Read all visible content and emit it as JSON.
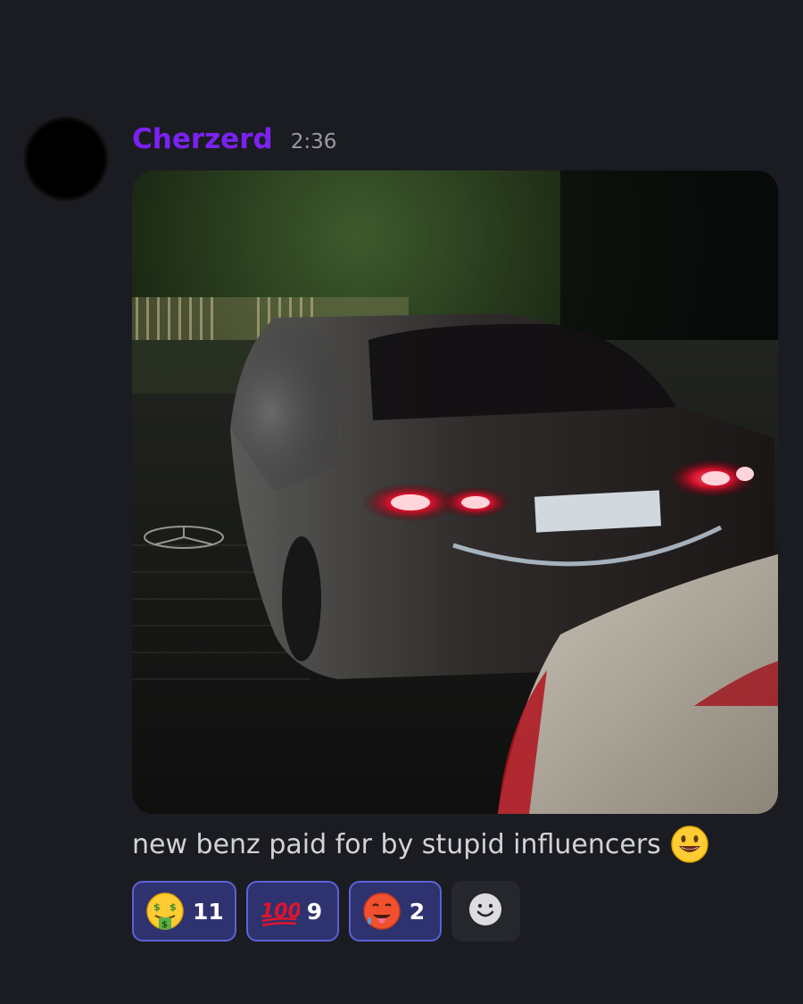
{
  "message": {
    "author": "Cherzerd",
    "timestamp": "2:36",
    "text": "new benz paid for by stupid influencers",
    "text_emoji": "smiling-face-with-open-mouth-emoji"
  },
  "reactions": [
    {
      "emoji": "money-mouth-face-emoji",
      "count": "11",
      "active": true
    },
    {
      "emoji": "hundred-points-emoji",
      "count": "9",
      "active": true
    },
    {
      "emoji": "hot-face-emoji",
      "count": "2",
      "active": true
    }
  ],
  "add_reaction": {
    "icon": "add-reaction-icon"
  },
  "colors": {
    "background": "#1b1c21",
    "username": "#7a22f2",
    "reaction_active_bg": "#2e3370",
    "reaction_active_border": "#5b62d6"
  }
}
